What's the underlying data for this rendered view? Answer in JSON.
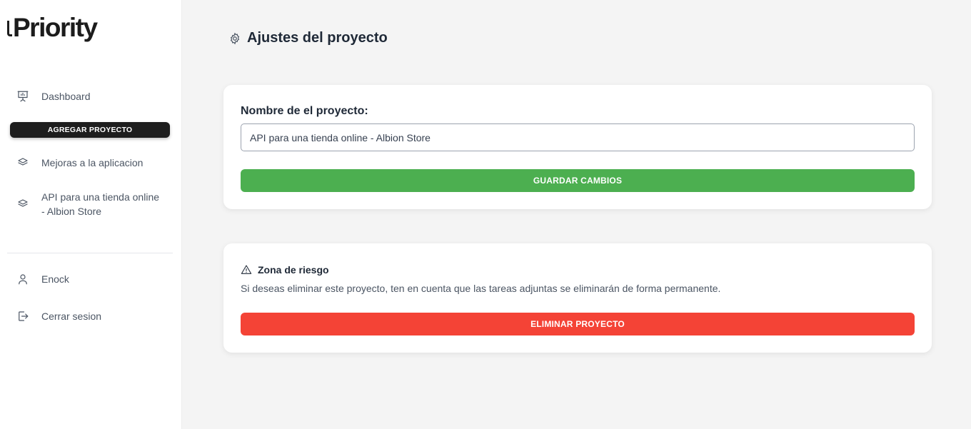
{
  "app": {
    "logo_text": "Priority"
  },
  "sidebar": {
    "dashboard": {
      "label": "Dashboard",
      "icon": "presentation-board-icon"
    },
    "add_project_label": "AGREGAR PROYECTO",
    "projects": [
      {
        "label": "Mejoras a la aplicacion",
        "icon": "layers-icon"
      },
      {
        "label": "API para una tienda online - Albion Store",
        "icon": "layers-icon"
      }
    ],
    "user": {
      "label": "Enock",
      "icon": "user-icon"
    },
    "logout": {
      "label": "Cerrar sesion",
      "icon": "logout-icon"
    }
  },
  "main": {
    "title": "Ajustes del proyecto",
    "title_icon": "gear-icon",
    "settings_card": {
      "field_label": "Nombre de el proyecto:",
      "project_name_value": "API para una tienda online - Albion Store",
      "save_label": "GUARDAR CAMBIOS"
    },
    "danger_card": {
      "title": "Zona de riesgo",
      "title_icon": "warning-icon",
      "description": "Si deseas eliminar este proyecto, ten en cuenta que las tareas adjuntas se eliminarán de forma permanente.",
      "delete_label": "ELIMINAR PROYECTO"
    }
  },
  "colors": {
    "save": "#4caf50",
    "delete": "#f44336",
    "add_project": "#1e1e1e",
    "background": "#f4f4f4"
  }
}
